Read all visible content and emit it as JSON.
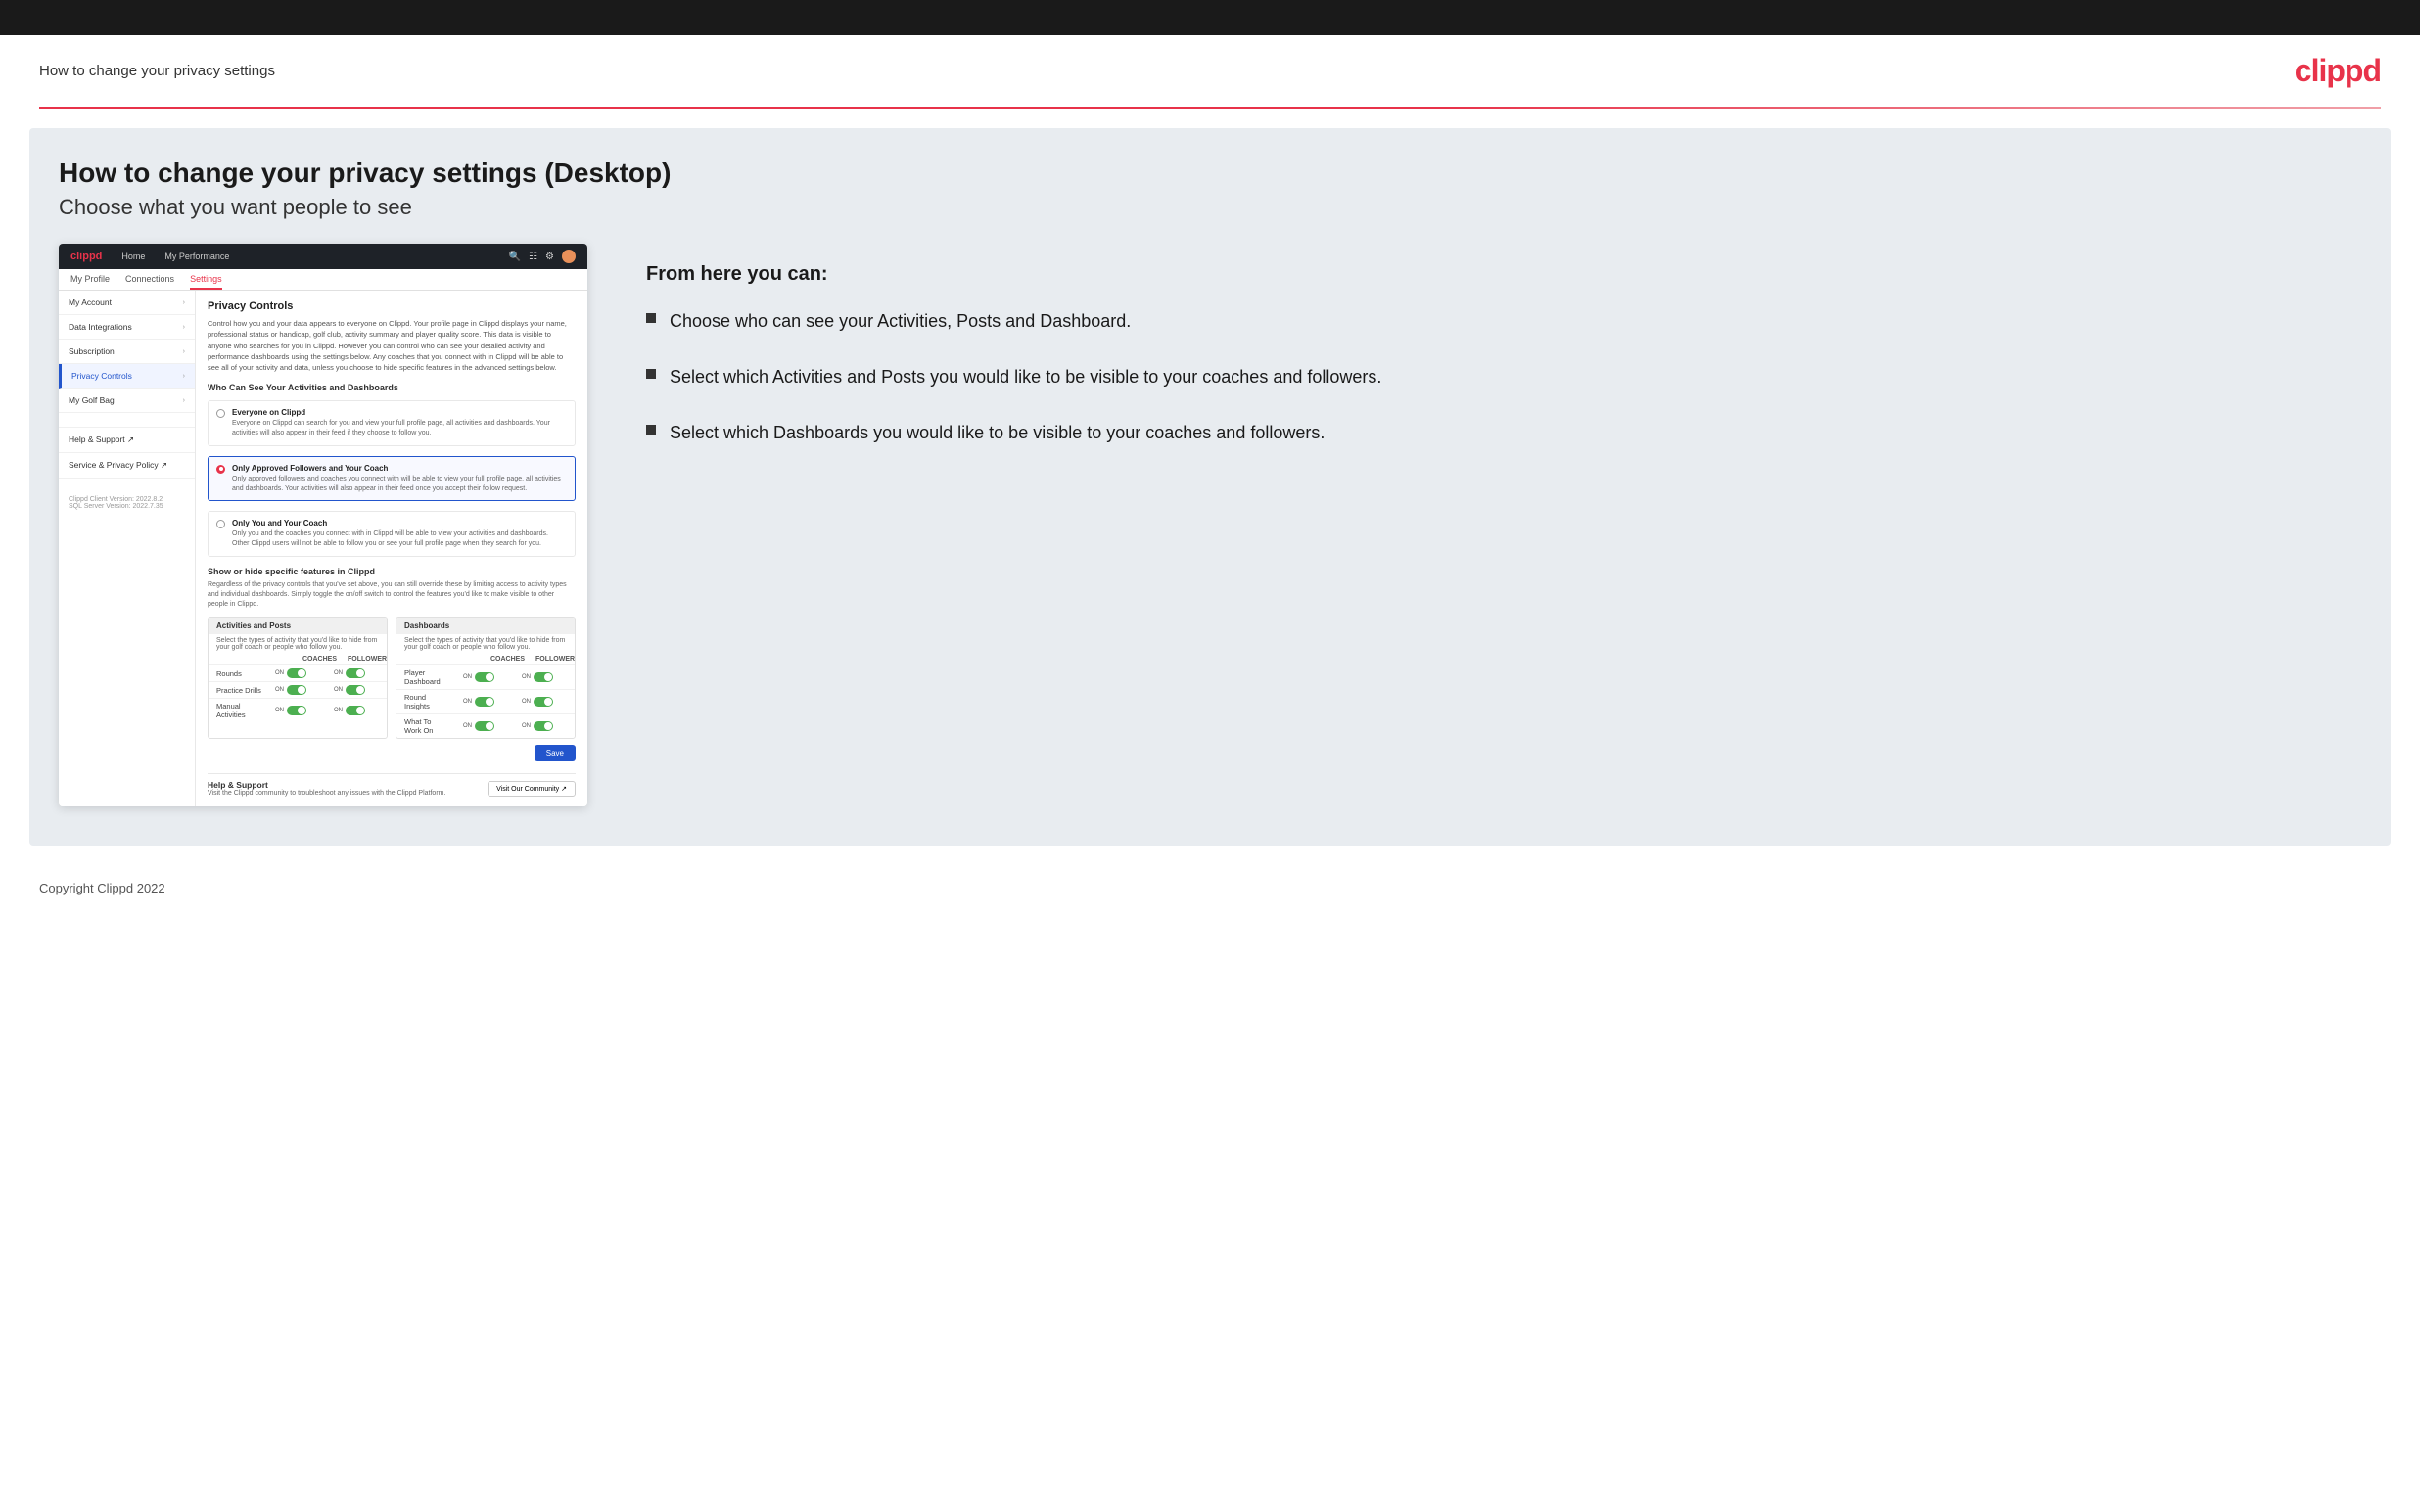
{
  "topBar": {},
  "header": {
    "title": "How to change your privacy settings",
    "logo": "clippd"
  },
  "main": {
    "heading": "How to change your privacy settings (Desktop)",
    "subheading": "Choose what you want people to see",
    "fromHereTitle": "From here you can:",
    "bullets": [
      {
        "text": "Choose who can see your Activities, Posts and Dashboard."
      },
      {
        "text": "Select which Activities and Posts you would like to be visible to your coaches and followers."
      },
      {
        "text": "Select which Dashboards you would like to be visible to your coaches and followers."
      }
    ]
  },
  "app": {
    "navbar": {
      "logo": "clippd",
      "links": [
        "Home",
        "My Performance"
      ]
    },
    "subnav": {
      "items": [
        "My Profile",
        "Connections",
        "Settings"
      ]
    },
    "sidebar": {
      "items": [
        {
          "label": "My Account",
          "active": false
        },
        {
          "label": "Data Integrations",
          "active": false
        },
        {
          "label": "Subscription",
          "active": false
        },
        {
          "label": "Privacy Controls",
          "active": true
        },
        {
          "label": "My Golf Bag",
          "active": false
        },
        {
          "label": "",
          "active": false
        },
        {
          "label": "Help & Support ↗",
          "active": false
        },
        {
          "label": "Service & Privacy Policy ↗",
          "active": false
        }
      ],
      "footer": {
        "line1": "Clippd Client Version: 2022.8.2",
        "line2": "SQL Server Version: 2022.7.35"
      }
    },
    "panel": {
      "title": "Privacy Controls",
      "desc": "Control how you and your data appears to everyone on Clippd. Your profile page in Clippd displays your name, professional status or handicap, golf club, activity summary and player quality score. This data is visible to anyone who searches for you in Clippd. However you can control who can see your detailed activity and performance dashboards using the settings below. Any coaches that you connect with in Clippd will be able to see all of your activity and data, unless you choose to hide specific features in the advanced settings below.",
      "whoCanSeeTitle": "Who Can See Your Activities and Dashboards",
      "radioOptions": [
        {
          "label": "Everyone on Clippd",
          "desc": "Everyone on Clippd can search for you and view your full profile page, all activities and dashboards. Your activities will also appear in their feed if they choose to follow you.",
          "selected": false
        },
        {
          "label": "Only Approved Followers and Your Coach",
          "desc": "Only approved followers and coaches you connect with will be able to view your full profile page, all activities and dashboards. Your activities will also appear in their feed once you accept their follow request.",
          "selected": true
        },
        {
          "label": "Only You and Your Coach",
          "desc": "Only you and the coaches you connect with in Clippd will be able to view your activities and dashboards. Other Clippd users will not be able to follow you or see your full profile page when they search for you.",
          "selected": false
        }
      ],
      "showHideTitle": "Show or hide specific features in Clippd",
      "showHideDesc": "Regardless of the privacy controls that you've set above, you can still override these by limiting access to activity types and individual dashboards. Simply toggle the on/off switch to control the features you'd like to make visible to other people in Clippd.",
      "activitiesCard": {
        "title": "Activities and Posts",
        "desc": "Select the types of activity that you'd like to hide from your golf coach or people who follow you.",
        "colHeaders": [
          "COACHES",
          "FOLLOWERS"
        ],
        "rows": [
          {
            "label": "Rounds",
            "coachOn": true,
            "followerOn": true
          },
          {
            "label": "Practice Drills",
            "coachOn": true,
            "followerOn": true
          },
          {
            "label": "Manual Activities",
            "coachOn": true,
            "followerOn": true
          }
        ]
      },
      "dashboardsCard": {
        "title": "Dashboards",
        "desc": "Select the types of activity that you'd like to hide from your golf coach or people who follow you.",
        "colHeaders": [
          "COACHES",
          "FOLLOWERS"
        ],
        "rows": [
          {
            "label": "Player Dashboard",
            "coachOn": true,
            "followerOn": true
          },
          {
            "label": "Round Insights",
            "coachOn": true,
            "followerOn": true
          },
          {
            "label": "What To Work On",
            "coachOn": true,
            "followerOn": true
          }
        ]
      },
      "saveLabel": "Save",
      "helpSection": {
        "title": "Help & Support",
        "desc": "Visit the Clippd community to troubleshoot any issues with the Clippd Platform.",
        "buttonLabel": "Visit Our Community ↗"
      }
    }
  },
  "footer": {
    "copyright": "Copyright Clippd 2022"
  }
}
